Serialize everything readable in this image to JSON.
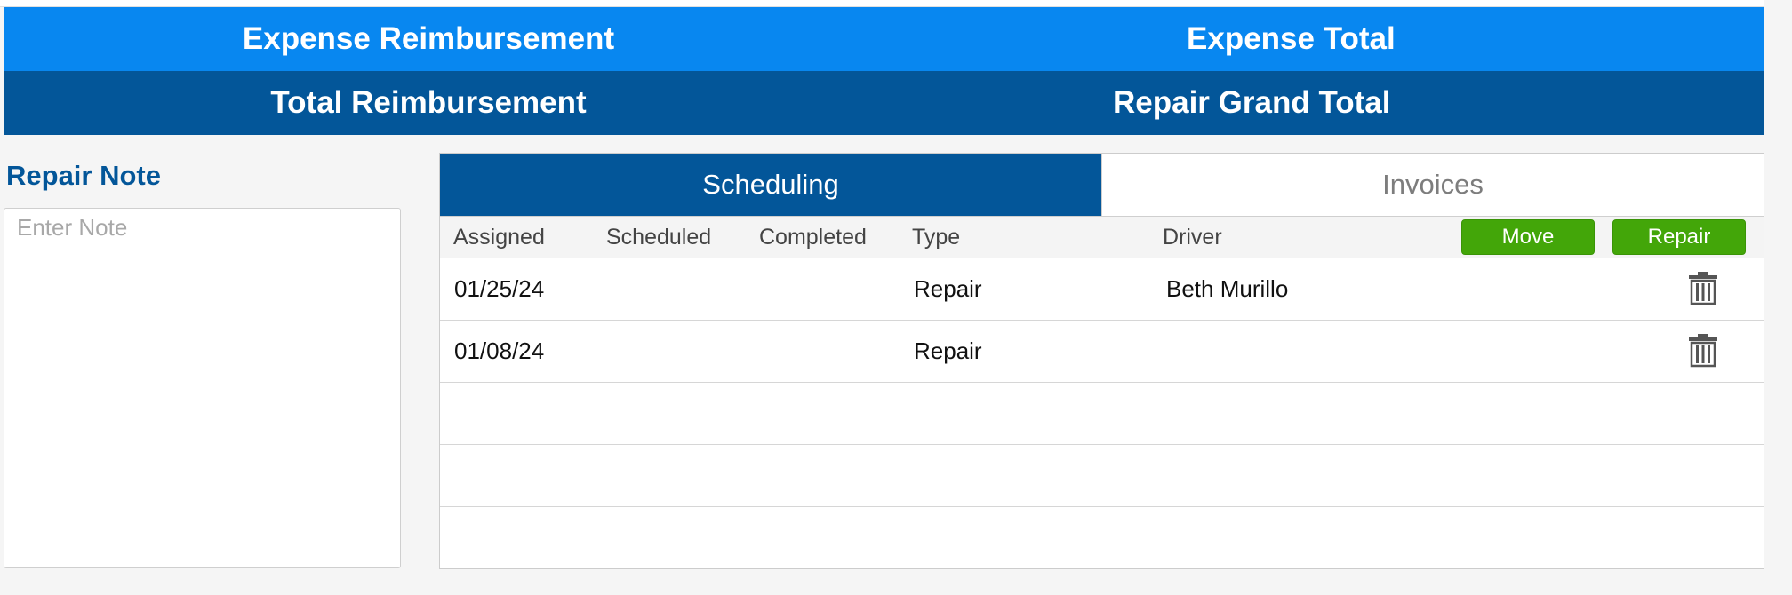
{
  "summary": {
    "row1": {
      "left": "Expense Reimbursement",
      "right": "Expense Total"
    },
    "row2": {
      "left": "Total Reimbursement",
      "right": "Repair Grand Total"
    }
  },
  "note": {
    "title": "Repair Note",
    "placeholder": "Enter Note",
    "value": ""
  },
  "tabs": [
    {
      "label": "Scheduling",
      "active": true
    },
    {
      "label": "Invoices",
      "active": false
    }
  ],
  "table": {
    "columns": [
      "Assigned",
      "Scheduled",
      "Completed",
      "Type",
      "Driver"
    ],
    "actions": {
      "move_label": "Move",
      "repair_label": "Repair"
    },
    "rows": [
      {
        "assigned": "01/25/24",
        "scheduled": "",
        "completed": "",
        "type": "Repair",
        "driver": "Beth Murillo",
        "action_icon": "trash-icon"
      },
      {
        "assigned": "01/08/24",
        "scheduled": "",
        "completed": "",
        "type": "Repair",
        "driver": "",
        "action_icon": "trash-icon"
      }
    ]
  },
  "colors": {
    "band_light": "#0887f0",
    "band_dark": "#035699",
    "action_green": "#43a609"
  }
}
